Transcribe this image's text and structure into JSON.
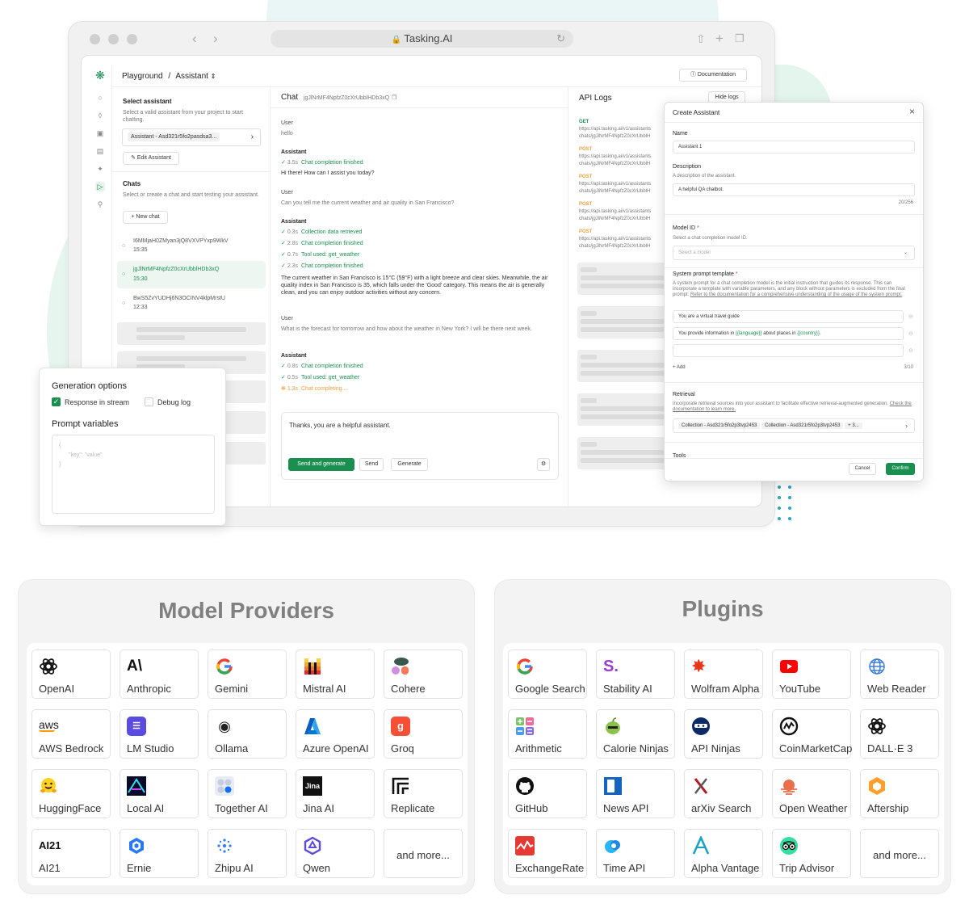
{
  "browser": {
    "url": "Tasking.AI"
  },
  "app": {
    "breadcrumb_root": "Playground",
    "breadcrumb_sep": "/",
    "breadcrumb_current": "Assistant",
    "documentation": "Documentation",
    "select_assistant": {
      "title": "Select assistant",
      "desc": "Select a valid assistant from your project to start chatting.",
      "value": "Assistant - Asd321r5fo2pasdsa3...",
      "edit": "Edit Assistant"
    },
    "chats": {
      "title": "Chats",
      "desc": "Select or create a chat and start testing your assistant.",
      "new": "New chat",
      "items": [
        {
          "id": "I6MMjaH0ZMyan3jQ8VXVPYxp9WkV",
          "time": "15:35"
        },
        {
          "id": "jgJlNrMF4NpfzZ0cXrUbblHDb3xQ",
          "time": "15:30"
        },
        {
          "id": "BwS5ZvYUDHj6N3OCINV4klpMrstU",
          "time": "12:33"
        }
      ]
    },
    "chat": {
      "title": "Chat",
      "id": "jgJlNrMF4NpfzZ0cXrUbblHDb3xQ",
      "user_label": "User",
      "assistant_label": "Assistant",
      "msg1": "hello",
      "a1_time": "3.5s",
      "a1_status": "Chat completion finished",
      "a1_text": "Hi there! How can I assist you today?",
      "msg2": "Can you tell me the current weather and air quality in San Francisco?",
      "a2_steps": [
        {
          "time": "0.3s",
          "text": "Collection data retrieved"
        },
        {
          "time": "2.8s",
          "text": "Chat completion finished"
        },
        {
          "time": "0.7s",
          "text": "Tool used: get_weather"
        },
        {
          "time": "2.3s",
          "text": "Chat completion finished"
        }
      ],
      "a2_text": "The current weather in San Francisco is 15°C (59°F) with a light breeze and clear skies. Meanwhile, the air quality index in San Francisco is 35, which falls under the 'Good' category. This means the air is generally clean, and you can enjoy outdoor activities without any concern.",
      "msg3": "What is the forecast for tomorrow and how about the weather in New York? I will be there next week.",
      "a3_steps": [
        {
          "time": "0.8s",
          "text": "Chat completion finished"
        },
        {
          "time": "0.5s",
          "text": "Tool used: get_weather"
        }
      ],
      "a3_pending_time": "1.3s",
      "a3_pending": "Chat completing...",
      "input": "Thanks, you are a helpful assistant.",
      "send_generate": "Send and generate",
      "send": "Send",
      "generate": "Generate"
    },
    "api_logs": {
      "title": "API Logs",
      "hide": "Hide logs",
      "entries": [
        {
          "method": "GET",
          "l1": "https://api.tasking.ai/v1/assistants",
          "l2": "chats/jgJlNrMF4NpfzZ0cXrUbblH"
        },
        {
          "method": "POST",
          "l1": "https://api.tasking.ai/v1/assistants",
          "l2": "chats/jgJlNrMF4NpfzZ0cXrUbblH"
        },
        {
          "method": "POST",
          "l1": "https://api.tasking.ai/v1/assistants",
          "l2": "chats/jgJlNrMF4NpfzZ0cXrUbblH"
        },
        {
          "method": "POST",
          "l1": "https://api.tasking.ai/v1/assistants",
          "l2": "chats/jgJlNrMF4NpfzZ0cXrUbblH"
        },
        {
          "method": "POST",
          "l1": "https://api.tasking.ai/v1/assistants",
          "l2": "chats/jgJlNrMF4NpfzZ0cXrUbblH"
        }
      ]
    }
  },
  "modal": {
    "title": "Create Assistant",
    "name_label": "Name",
    "name_value": "Assistant 1",
    "desc_label": "Description",
    "desc_hint": "A description of the assistant.",
    "desc_value": "A helpful QA chatbot.",
    "desc_count": "20/256",
    "model_label": "Model ID",
    "model_req": "*",
    "model_hint": "Select a chat completion model ID.",
    "model_placeholder": "Select a model",
    "prompt_label": "System prompt template",
    "prompt_req": "*",
    "prompt_hint": "A system prompt for a chat completion model is the initial instruction that guides its response. This can incorporate a template with variable parameters, and any block without parameters is excluded from the final prompt.",
    "prompt_link": "Refer to the documentation for a comprehensive understanding of the usage of the system prompt.",
    "prompt1": "You are a virtual travel guide",
    "prompt2_a": "You provide information in ",
    "prompt2_var1": "{{language}}",
    "prompt2_b": " about places in ",
    "prompt2_var2": "{{country}}",
    "prompt2_c": ".",
    "add": "Add",
    "add_count": "3/10",
    "retrieval_label": "Retrieval",
    "retrieval_hint": "Incorporate retrieval sources into your assistant to facilitate effective retrieval-augmented generation.",
    "retrieval_link": "Check the documentation to learn more.",
    "collection1": "Collection - Asd321r5fo2p3tvp2453",
    "collection2": "Collection - Asd321r5fo2p3tvp2453",
    "collection_more": "+ 3...",
    "tools_label": "Tools",
    "cancel": "Cancel",
    "confirm": "Confirm"
  },
  "gen": {
    "title": "Generation options",
    "stream": "Response in stream",
    "debug": "Debug log",
    "vars_title": "Prompt variables",
    "vars_l1": "{",
    "vars_l2": "\"key\": \"value\"",
    "vars_l3": "}"
  },
  "providers": {
    "title": "Model Providers",
    "items": [
      "OpenAI",
      "Anthropic",
      "Gemini",
      "Mistral AI",
      "Cohere",
      "AWS Bedrock",
      "LM Studio",
      "Ollama",
      "Azure OpenAI",
      "Groq",
      "HuggingFace",
      "Local AI",
      "Together AI",
      "Jina AI",
      "Replicate",
      "AI21",
      "Ernie",
      "Zhipu AI",
      "Qwen"
    ],
    "more": "and more..."
  },
  "plugins": {
    "title": "Plugins",
    "items": [
      "Google Search",
      "Stability AI",
      "Wolfram Alpha",
      "YouTube",
      "Web Reader",
      "Arithmetic",
      "Calorie Ninjas",
      "API Ninjas",
      "CoinMarketCap",
      "DALL·E 3",
      "GitHub",
      "News API",
      "arXiv Search",
      "Open Weather",
      "Aftership",
      "ExchangeRate",
      "Time API",
      "Alpha Vantage",
      "Trip Advisor"
    ],
    "more": "and more..."
  },
  "icon_text": {
    "aws": "aws",
    "ai21": "AI21",
    "jina": "Jina",
    "groq": "g",
    "stability": "S.",
    "anthropic": "A\\"
  },
  "colors": {
    "accent": "#1a8f4f",
    "orange": "#f0a040"
  }
}
